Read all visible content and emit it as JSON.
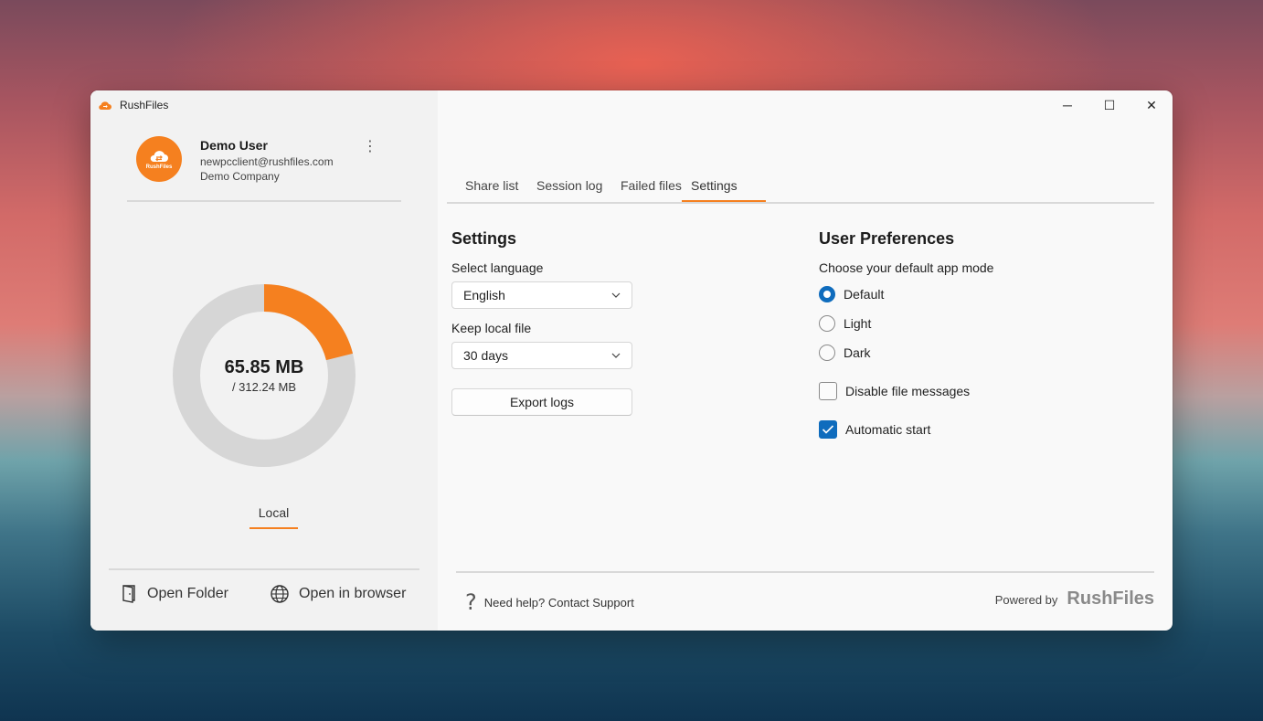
{
  "app": {
    "title": "RushFiles",
    "accent": "#f5801f"
  },
  "window_controls": {
    "minimize": "─",
    "maximize": "☐",
    "close": "✕"
  },
  "profile": {
    "name": "Demo User",
    "email": "newpcclient@rushfiles.com",
    "company": "Demo Company",
    "avatar_label": "RushFiles",
    "menu_icon": "⋮"
  },
  "storage": {
    "used_label": "65.85 MB",
    "total_label": "/ 312.24 MB",
    "used_fraction": 0.211,
    "tab_label": "Local"
  },
  "left_actions": {
    "open_folder": "Open Folder",
    "open_browser": "Open in browser"
  },
  "tabs": [
    {
      "label": "Share list",
      "active": false
    },
    {
      "label": "Session log",
      "active": false
    },
    {
      "label": "Failed files",
      "active": false
    },
    {
      "label": "Settings",
      "active": true
    }
  ],
  "settings": {
    "title": "Settings",
    "language_label": "Select language",
    "language_value": "English",
    "keep_label": "Keep local file",
    "keep_value": "30 days",
    "export_button": "Export logs"
  },
  "preferences": {
    "title": "User Preferences",
    "mode_label": "Choose your default app mode",
    "modes": [
      {
        "label": "Default",
        "selected": true
      },
      {
        "label": "Light",
        "selected": false
      },
      {
        "label": "Dark",
        "selected": false
      }
    ],
    "disable_messages": {
      "label": "Disable file messages",
      "checked": false
    },
    "automatic_start": {
      "label": "Automatic start",
      "checked": true
    }
  },
  "footer": {
    "help_icon": "?",
    "help_text": "Need help? Contact Support",
    "powered_by": "Powered by",
    "brand": "RushFiles"
  }
}
